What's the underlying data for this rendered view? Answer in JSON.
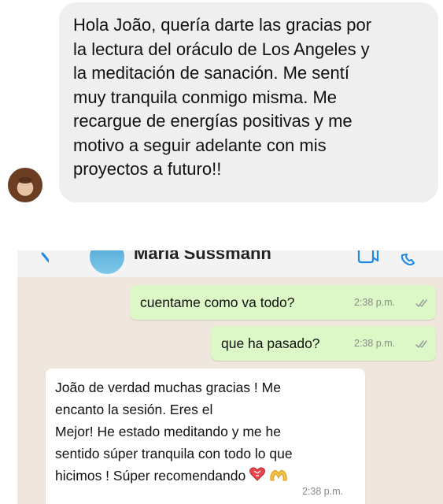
{
  "instagram": {
    "message_text": "Hola João, quería darte las gracias por\nla lectura del oráculo de Los Angeles y\nla meditación de sanación. Me sentí\nmuy tranquila conmigo misma. Me\nrecargue de energías positivas y me\nmotivo a seguir adelante con mis\nproyectos a futuro!!",
    "bubble_color": "#efefef"
  },
  "whatsapp": {
    "contact_name": "Maria Sussmann",
    "icons": [
      "back-arrow-icon",
      "video-call-icon",
      "phone-icon"
    ],
    "messages": [
      {
        "direction": "outgoing",
        "text": "cuentame como va todo?",
        "time": "2:38 p.m.",
        "status": "read-double-check"
      },
      {
        "direction": "outgoing",
        "text": "que ha pasado?",
        "time": "2:38 p.m.",
        "status": "read-double-check"
      },
      {
        "direction": "incoming",
        "text": "João de verdad muchas gracias ! Me\nencanto la sesión. Eres el\nMejor! He estado meditando y me he\nsentido súper tranquila con todo lo que\nhicimos ! Súper recomendando",
        "emojis": [
          "heart-icon",
          "heart-hands-icon"
        ],
        "time": "2:38 p.m."
      }
    ],
    "colors": {
      "chat_background": "#efe7dd",
      "outgoing_bubble": "#dcf8c6",
      "incoming_bubble": "#ffffff",
      "header": "#f3f3f3",
      "accent": "#1e88e5"
    }
  }
}
